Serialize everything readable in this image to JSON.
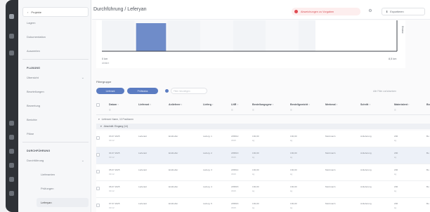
{
  "header": {
    "title": "Durchführung / Leferyan",
    "alert_label": "Abweichungen zu Vorgaben",
    "export_label": "Exportieren",
    "settings_icon": "gear-icon"
  },
  "sidebar": {
    "back_label": "Projekte",
    "items": [
      {
        "label": "Lagern",
        "type": "item"
      },
      {
        "label": "Dokumentation",
        "type": "item"
      },
      {
        "label": "Auswerten",
        "type": "item"
      },
      {
        "label": "PLANUNG",
        "type": "section"
      },
      {
        "label": "Übersicht",
        "type": "item",
        "chevron": true
      },
      {
        "label": "Beurteilungen",
        "type": "item"
      },
      {
        "label": "Bewertung",
        "type": "item"
      },
      {
        "label": "Berichte",
        "type": "item"
      },
      {
        "label": "Pläne",
        "type": "item"
      },
      {
        "label": "DURCHFÜHRUNG",
        "type": "section"
      },
      {
        "label": "Durchführung",
        "type": "item",
        "chevron": true
      },
      {
        "label": "Lieferanten",
        "type": "sub"
      },
      {
        "label": "Prüfungen",
        "type": "sub"
      },
      {
        "label": "Leferyan",
        "type": "sub",
        "active": true
      }
    ]
  },
  "chart": {
    "x_start_label": "0 km",
    "x_start_sub": "Abfahrt",
    "x_end_label": "8,5 km",
    "y_right_label": "Distanz"
  },
  "chart_data": {
    "type": "bar",
    "categories": [
      "",
      "",
      "",
      "",
      "",
      "",
      "",
      "",
      ""
    ],
    "values": [
      0,
      1,
      0,
      0,
      0,
      0,
      0,
      0,
      0
    ],
    "xlabel": "",
    "ylabel": "",
    "x_range": [
      "0 km",
      "8,5 km"
    ]
  },
  "filters": {
    "title": "Filtergruppe",
    "chips": [
      "Lieferant",
      "Prüfstatus"
    ],
    "input_placeholder": "Filter hinzufügen",
    "right_label": "Alle Filter zurücksetzen"
  },
  "table": {
    "columns": [
      {
        "label": "Datum ↑",
        "sub": "☰"
      },
      {
        "label": "Lieferant ↑",
        "sub": ""
      },
      {
        "label": "Anlieferer ↑",
        "sub": ""
      },
      {
        "label": "Lieferg ↑",
        "sub": ""
      },
      {
        "label": "LNR ↑",
        "sub": "☰"
      },
      {
        "label": "Bestellungsgew ↑",
        "sub": "☰"
      },
      {
        "label": "Bestellgewicht ↑",
        "sub": "☰"
      },
      {
        "label": "Merkmal ↑",
        "sub": ""
      },
      {
        "label": "Schritt ↑",
        "sub": ""
      },
      {
        "label": "Materialent ↑",
        "sub": "☰"
      },
      {
        "label": "Bo",
        "sub": ""
      }
    ],
    "groups": [
      "Lieferant: Name, 10 Positionen",
      "Abschnitt: Eingang (14)"
    ],
    "rows": [
      {
        "cells": [
          "03.07.2025",
          "Lieferant",
          "Ersthelfer",
          "Lieferg. 1",
          "245812",
          "130,00",
          "130,00",
          "Merkmal A",
          "Anlieferung",
          "200",
          "Bo"
        ]
      },
      {
        "cells": [
          "04.07.2025",
          "Lieferant",
          "Ersthelfer",
          "Lieferg. 2",
          "245813",
          "130,00",
          "130,00",
          "Merkmal A",
          "Anlieferung",
          "200",
          "Bo"
        ]
      },
      {
        "cells": [
          "05.07.2025",
          "Lieferant",
          "Ersthelfer",
          "Lieferg. 3",
          "245814",
          "130,00",
          "130,00",
          "Merkmal A",
          "Anlieferung",
          "200",
          "Bo"
        ]
      },
      {
        "cells": [
          "06.07.2025",
          "Lieferant",
          "Ersthelfer",
          "Lieferg. 4",
          "245815",
          "130,00",
          "130,00",
          "Merkmal A",
          "Anlieferung",
          "200",
          "Bo"
        ]
      },
      {
        "cells": [
          "07.07.2025",
          "Lieferant",
          "Ersthelfer",
          "Lieferg. 5",
          "245816",
          "130,00",
          "130,00",
          "Merkmal A",
          "Anlieferung",
          "200",
          "Bo"
        ]
      }
    ],
    "row_sublines": [
      "09:12",
      "",
      "",
      "",
      "0815",
      "kg",
      "kg",
      "",
      "",
      "kg",
      ""
    ]
  },
  "colors": {
    "accent": "#5b7cc2",
    "bar": "#6f8cc9",
    "alert": "#e04a52",
    "rail": "#2f3237"
  }
}
